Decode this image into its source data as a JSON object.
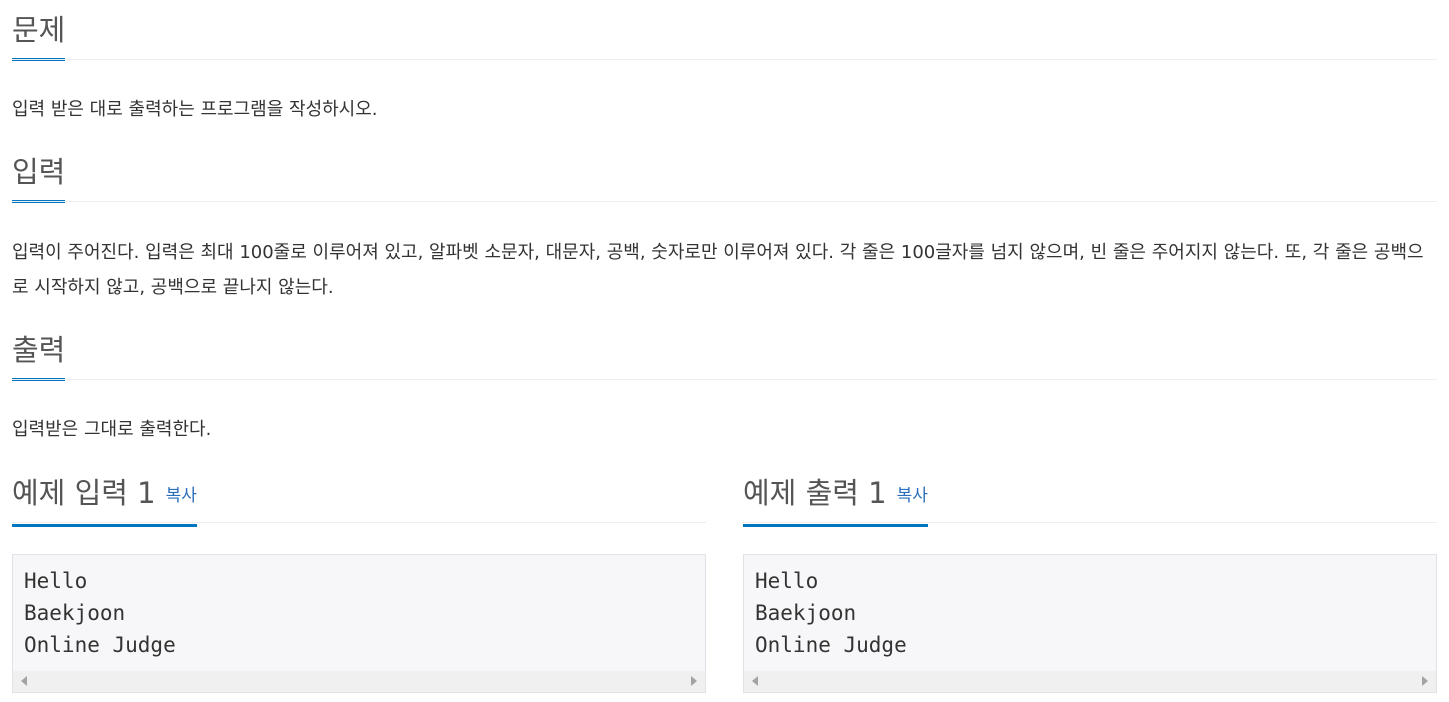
{
  "problem": {
    "title": "문제",
    "description": "입력 받은 대로 출력하는 프로그램을 작성하시오."
  },
  "input": {
    "title": "입력",
    "description": "입력이 주어진다. 입력은 최대 100줄로 이루어져 있고, 알파벳 소문자, 대문자, 공백, 숫자로만 이루어져 있다. 각 줄은 100글자를 넘지 않으며, 빈 줄은 주어지지 않는다. 또, 각 줄은 공백으로 시작하지 않고, 공백으로 끝나지 않는다."
  },
  "output": {
    "title": "출력",
    "description": "입력받은 그대로 출력한다."
  },
  "sample_input": {
    "title": "예제 입력 1",
    "copy_label": "복사",
    "content": "Hello\nBaekjoon\nOnline Judge"
  },
  "sample_output": {
    "title": "예제 출력 1",
    "copy_label": "복사",
    "content": "Hello\nBaekjoon\nOnline Judge"
  },
  "colors": {
    "accent": "#0076c0",
    "link": "#2a6ebb",
    "sample_bg": "#f7f7f9"
  }
}
